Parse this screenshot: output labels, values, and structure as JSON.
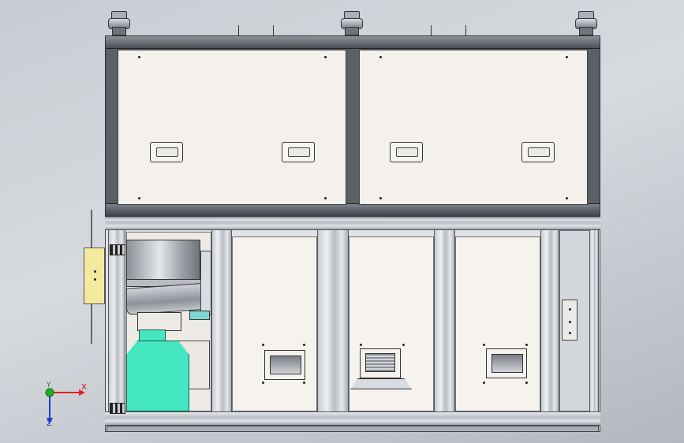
{
  "triad": {
    "x_label": "X",
    "y_label": "Y",
    "z_label": "Z",
    "x_color": "#e02020",
    "y_color": "#20b020",
    "z_color": "#2040d0"
  },
  "colors": {
    "tank": "#45e6c2",
    "side_box": "#f3eaa0",
    "panel": "#f4f1ec",
    "frame": "#5b5f66"
  }
}
